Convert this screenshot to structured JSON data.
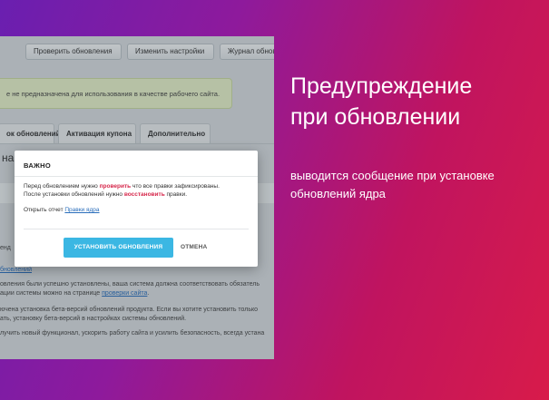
{
  "toolbar": {
    "check_updates": "Проверить обновления",
    "change_settings": "Изменить настройки",
    "update_log": "Журнал обновлений"
  },
  "notice_text": "е не предназначена для использования в качестве рабочего сайта.",
  "tabs": [
    {
      "label": "ок обновлений"
    },
    {
      "label": "Активация купона"
    },
    {
      "label": "Дополнительно"
    }
  ],
  "panel_heading": "на",
  "background_lines": {
    "fragment_a": "енд",
    "link_updates": "бновлений",
    "line1": "овления были успешно установлены, ваша система должна соответствовать обязатель",
    "line2_text": "ации системы можно на странице ",
    "line2_link": "проверки сайта",
    "line2_end": ".",
    "line3": "ючена установка бета-версий обновлений продукта. Если вы хотите установить только",
    "line4": "ать, установку бета-версий в настройках системы обновлений.",
    "line5": "лучить новый функционал, ускорить работу сайта и усилить безопасность, всегда устана"
  },
  "modal": {
    "title": "ВАЖНО",
    "line1_before": "Перед обновлением нужно ",
    "line1_highlight": "проверить",
    "line1_after": " что все правки зафиксированы.",
    "line2_before": "После установки обновлений нужно ",
    "line2_highlight": "восстановить",
    "line2_after": " правки.",
    "open_report_text": "Открыть отчет ",
    "open_report_link": "Правки ядра",
    "install_button": "УСТАНОВИТЬ ОБНОВЛЕНИЯ",
    "cancel_button": "ОТМЕНА"
  },
  "heading_line1": "Предупреждение",
  "heading_line2": "при обновлении",
  "subtext_line1": "выводится сообщение при установке",
  "subtext_line2": "обновлений ядра",
  "colors": {
    "accent_button": "#3bb7e3",
    "highlight_red": "#d6264a",
    "gradient_start": "#6a1fb0",
    "gradient_end": "#d81b4a"
  }
}
